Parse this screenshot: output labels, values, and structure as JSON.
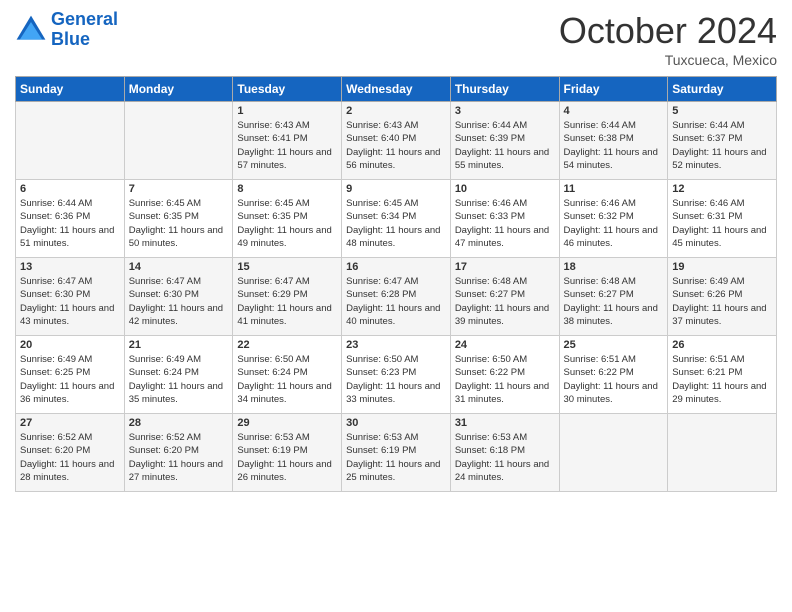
{
  "logo": {
    "line1": "General",
    "line2": "Blue"
  },
  "title": "October 2024",
  "subtitle": "Tuxcueca, Mexico",
  "weekdays": [
    "Sunday",
    "Monday",
    "Tuesday",
    "Wednesday",
    "Thursday",
    "Friday",
    "Saturday"
  ],
  "weeks": [
    [
      {
        "day": "",
        "sunrise": "",
        "sunset": "",
        "daylight": ""
      },
      {
        "day": "",
        "sunrise": "",
        "sunset": "",
        "daylight": ""
      },
      {
        "day": "1",
        "sunrise": "Sunrise: 6:43 AM",
        "sunset": "Sunset: 6:41 PM",
        "daylight": "Daylight: 11 hours and 57 minutes."
      },
      {
        "day": "2",
        "sunrise": "Sunrise: 6:43 AM",
        "sunset": "Sunset: 6:40 PM",
        "daylight": "Daylight: 11 hours and 56 minutes."
      },
      {
        "day": "3",
        "sunrise": "Sunrise: 6:44 AM",
        "sunset": "Sunset: 6:39 PM",
        "daylight": "Daylight: 11 hours and 55 minutes."
      },
      {
        "day": "4",
        "sunrise": "Sunrise: 6:44 AM",
        "sunset": "Sunset: 6:38 PM",
        "daylight": "Daylight: 11 hours and 54 minutes."
      },
      {
        "day": "5",
        "sunrise": "Sunrise: 6:44 AM",
        "sunset": "Sunset: 6:37 PM",
        "daylight": "Daylight: 11 hours and 52 minutes."
      }
    ],
    [
      {
        "day": "6",
        "sunrise": "Sunrise: 6:44 AM",
        "sunset": "Sunset: 6:36 PM",
        "daylight": "Daylight: 11 hours and 51 minutes."
      },
      {
        "day": "7",
        "sunrise": "Sunrise: 6:45 AM",
        "sunset": "Sunset: 6:35 PM",
        "daylight": "Daylight: 11 hours and 50 minutes."
      },
      {
        "day": "8",
        "sunrise": "Sunrise: 6:45 AM",
        "sunset": "Sunset: 6:35 PM",
        "daylight": "Daylight: 11 hours and 49 minutes."
      },
      {
        "day": "9",
        "sunrise": "Sunrise: 6:45 AM",
        "sunset": "Sunset: 6:34 PM",
        "daylight": "Daylight: 11 hours and 48 minutes."
      },
      {
        "day": "10",
        "sunrise": "Sunrise: 6:46 AM",
        "sunset": "Sunset: 6:33 PM",
        "daylight": "Daylight: 11 hours and 47 minutes."
      },
      {
        "day": "11",
        "sunrise": "Sunrise: 6:46 AM",
        "sunset": "Sunset: 6:32 PM",
        "daylight": "Daylight: 11 hours and 46 minutes."
      },
      {
        "day": "12",
        "sunrise": "Sunrise: 6:46 AM",
        "sunset": "Sunset: 6:31 PM",
        "daylight": "Daylight: 11 hours and 45 minutes."
      }
    ],
    [
      {
        "day": "13",
        "sunrise": "Sunrise: 6:47 AM",
        "sunset": "Sunset: 6:30 PM",
        "daylight": "Daylight: 11 hours and 43 minutes."
      },
      {
        "day": "14",
        "sunrise": "Sunrise: 6:47 AM",
        "sunset": "Sunset: 6:30 PM",
        "daylight": "Daylight: 11 hours and 42 minutes."
      },
      {
        "day": "15",
        "sunrise": "Sunrise: 6:47 AM",
        "sunset": "Sunset: 6:29 PM",
        "daylight": "Daylight: 11 hours and 41 minutes."
      },
      {
        "day": "16",
        "sunrise": "Sunrise: 6:47 AM",
        "sunset": "Sunset: 6:28 PM",
        "daylight": "Daylight: 11 hours and 40 minutes."
      },
      {
        "day": "17",
        "sunrise": "Sunrise: 6:48 AM",
        "sunset": "Sunset: 6:27 PM",
        "daylight": "Daylight: 11 hours and 39 minutes."
      },
      {
        "day": "18",
        "sunrise": "Sunrise: 6:48 AM",
        "sunset": "Sunset: 6:27 PM",
        "daylight": "Daylight: 11 hours and 38 minutes."
      },
      {
        "day": "19",
        "sunrise": "Sunrise: 6:49 AM",
        "sunset": "Sunset: 6:26 PM",
        "daylight": "Daylight: 11 hours and 37 minutes."
      }
    ],
    [
      {
        "day": "20",
        "sunrise": "Sunrise: 6:49 AM",
        "sunset": "Sunset: 6:25 PM",
        "daylight": "Daylight: 11 hours and 36 minutes."
      },
      {
        "day": "21",
        "sunrise": "Sunrise: 6:49 AM",
        "sunset": "Sunset: 6:24 PM",
        "daylight": "Daylight: 11 hours and 35 minutes."
      },
      {
        "day": "22",
        "sunrise": "Sunrise: 6:50 AM",
        "sunset": "Sunset: 6:24 PM",
        "daylight": "Daylight: 11 hours and 34 minutes."
      },
      {
        "day": "23",
        "sunrise": "Sunrise: 6:50 AM",
        "sunset": "Sunset: 6:23 PM",
        "daylight": "Daylight: 11 hours and 33 minutes."
      },
      {
        "day": "24",
        "sunrise": "Sunrise: 6:50 AM",
        "sunset": "Sunset: 6:22 PM",
        "daylight": "Daylight: 11 hours and 31 minutes."
      },
      {
        "day": "25",
        "sunrise": "Sunrise: 6:51 AM",
        "sunset": "Sunset: 6:22 PM",
        "daylight": "Daylight: 11 hours and 30 minutes."
      },
      {
        "day": "26",
        "sunrise": "Sunrise: 6:51 AM",
        "sunset": "Sunset: 6:21 PM",
        "daylight": "Daylight: 11 hours and 29 minutes."
      }
    ],
    [
      {
        "day": "27",
        "sunrise": "Sunrise: 6:52 AM",
        "sunset": "Sunset: 6:20 PM",
        "daylight": "Daylight: 11 hours and 28 minutes."
      },
      {
        "day": "28",
        "sunrise": "Sunrise: 6:52 AM",
        "sunset": "Sunset: 6:20 PM",
        "daylight": "Daylight: 11 hours and 27 minutes."
      },
      {
        "day": "29",
        "sunrise": "Sunrise: 6:53 AM",
        "sunset": "Sunset: 6:19 PM",
        "daylight": "Daylight: 11 hours and 26 minutes."
      },
      {
        "day": "30",
        "sunrise": "Sunrise: 6:53 AM",
        "sunset": "Sunset: 6:19 PM",
        "daylight": "Daylight: 11 hours and 25 minutes."
      },
      {
        "day": "31",
        "sunrise": "Sunrise: 6:53 AM",
        "sunset": "Sunset: 6:18 PM",
        "daylight": "Daylight: 11 hours and 24 minutes."
      },
      {
        "day": "",
        "sunrise": "",
        "sunset": "",
        "daylight": ""
      },
      {
        "day": "",
        "sunrise": "",
        "sunset": "",
        "daylight": ""
      }
    ]
  ]
}
